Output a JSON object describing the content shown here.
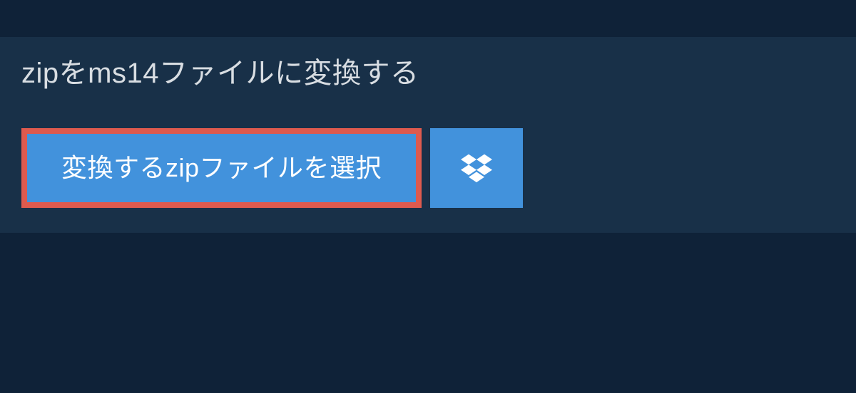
{
  "heading": "zipをms14ファイルに変換する",
  "buttons": {
    "select_file_label": "変換するzipファイルを選択"
  },
  "colors": {
    "page_bg": "#0f2238",
    "panel_bg": "#183048",
    "button_bg": "#4292dc",
    "highlight_border": "#de5a4e",
    "text": "#d8dde2"
  }
}
